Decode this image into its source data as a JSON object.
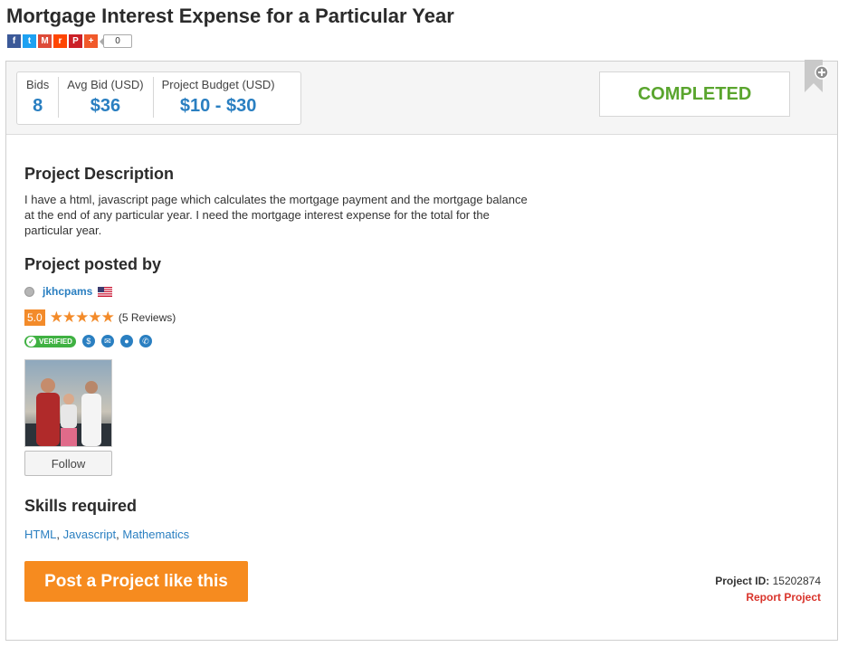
{
  "page_title": "Mortgage Interest Expense for a Particular Year",
  "share": {
    "buttons": [
      {
        "name": "facebook-icon",
        "glyph": "f",
        "color": "#3b5998"
      },
      {
        "name": "twitter-icon",
        "glyph": "t",
        "color": "#1da1f2"
      },
      {
        "name": "gmail-icon",
        "glyph": "M",
        "color": "#dd4b39"
      },
      {
        "name": "reddit-icon",
        "glyph": "r",
        "color": "#ff4500"
      },
      {
        "name": "pinterest-icon",
        "glyph": "P",
        "color": "#cb2027"
      },
      {
        "name": "plus-icon",
        "glyph": "+",
        "color": "#f1592a"
      }
    ],
    "count": "0"
  },
  "stats": {
    "bids_label": "Bids",
    "bids_value": "8",
    "avg_label": "Avg Bid (USD)",
    "avg_value": "$36",
    "budget_label": "Project Budget (USD)",
    "budget_value": "$10 - $30"
  },
  "status": "COMPLETED",
  "description": {
    "heading": "Project Description",
    "text": "I have a html, javascript page which calculates the mortgage payment and the mortgage balance at the end of any particular year. I need the mortgage interest expense for the total for the particular year."
  },
  "poster": {
    "heading": "Project posted by",
    "username": "jkhcpams",
    "country_flag": "us-flag-icon",
    "rating": "5.0",
    "stars": 5,
    "reviews": "(5 Reviews)",
    "verified_label": "VERIFIED",
    "follow_label": "Follow"
  },
  "skills": {
    "heading": "Skills required",
    "items": [
      "HTML",
      "Javascript",
      "Mathematics"
    ]
  },
  "cta_label": "Post a Project like this",
  "project_id_label": "Project ID:",
  "project_id": "15202874",
  "report_label": "Report Project",
  "colors": {
    "accent_blue": "#2a7fc1",
    "status_green": "#5aa52e",
    "cta_orange": "#f68b1f",
    "report_red": "#d9342b"
  }
}
